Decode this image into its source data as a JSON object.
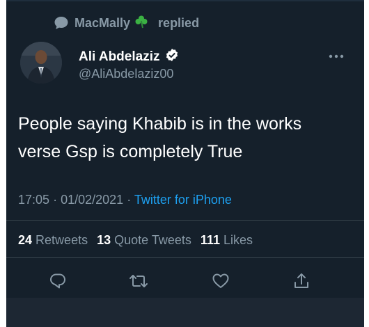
{
  "reply_context": {
    "user": "MacMally",
    "emoji": "☘",
    "action": "replied"
  },
  "author": {
    "name": "Ali Abdelaziz",
    "handle": "@AliAbdelaziz00",
    "verified": true
  },
  "tweet": {
    "text_line1": "People saying Khabib is in the works",
    "text_line2": "verse Gsp is completely True"
  },
  "meta": {
    "time": "17:05",
    "separator": "·",
    "date": "01/02/2021",
    "source": "Twitter for iPhone"
  },
  "stats": {
    "retweets_count": "24",
    "retweets_label": "Retweets",
    "quotes_count": "13",
    "quotes_label": "Quote Tweets",
    "likes_count": "111",
    "likes_label": "Likes"
  },
  "actions": [
    "reply-icon",
    "retweet-icon",
    "like-icon",
    "share-icon"
  ],
  "colors": {
    "background": "#15202b",
    "text": "#ffffff",
    "secondary": "#8899a6",
    "link": "#1da1f2",
    "verified": "#ffffff"
  }
}
